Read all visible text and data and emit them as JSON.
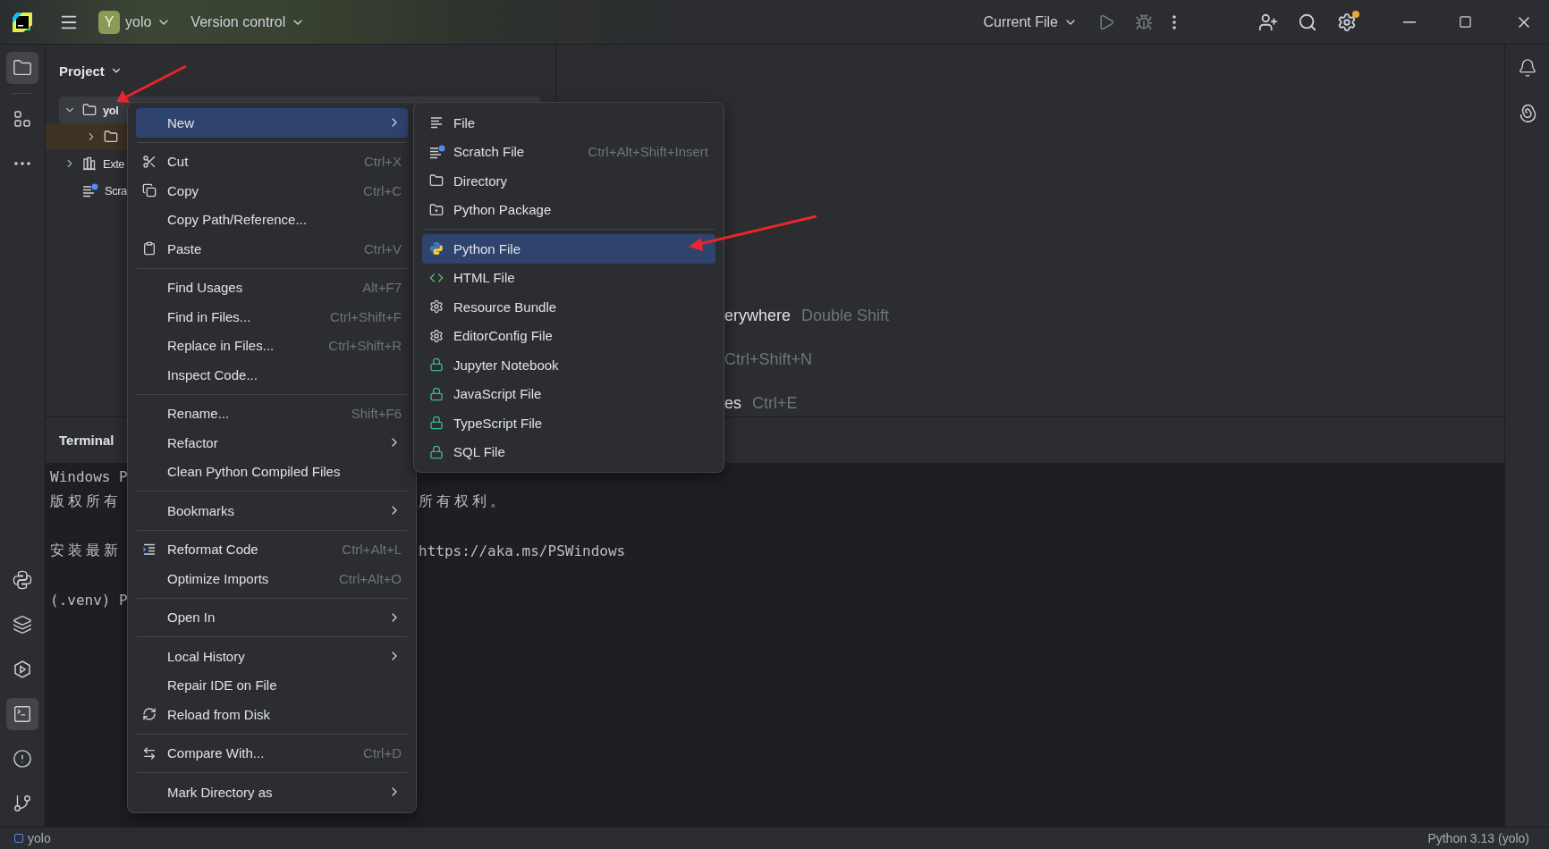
{
  "title_bar": {
    "project_initial": "Y",
    "project": "yolo",
    "vcs": "Version control",
    "run_config": "Current File",
    "run_disabled": true,
    "debug_disabled": true,
    "settings_badge": true
  },
  "tool_strip": {
    "top": [
      {
        "kind": "project",
        "selected": true
      },
      {
        "kind": "structure",
        "selected": false
      },
      {
        "kind": "more",
        "selected": false
      }
    ],
    "bottom": [
      {
        "kind": "python",
        "selected": false
      },
      {
        "kind": "layers",
        "selected": false
      },
      {
        "kind": "run",
        "selected": false
      },
      {
        "kind": "terminal",
        "selected": true
      },
      {
        "kind": "problems",
        "selected": false
      },
      {
        "kind": "git",
        "selected": false
      }
    ]
  },
  "project_panel": {
    "title": "Project",
    "tree": [
      {
        "label": "yol",
        "kind": "folder",
        "expanded": true,
        "selected": true,
        "excluded": false,
        "children": [
          {
            "kind": "folder",
            "expanded": false,
            "selected": false,
            "excluded": true
          }
        ]
      },
      {
        "label": "Exte",
        "kind": "library",
        "expanded": false,
        "selected": false,
        "excluded": false
      },
      {
        "label": "Scra",
        "kind": "scratch",
        "selected": false,
        "excluded": false
      }
    ]
  },
  "editor_hints": [
    {
      "action": "erywhere",
      "shortcut": "Double Shift"
    },
    {
      "shortcut": "Ctrl+Shift+N"
    },
    {
      "action": "es",
      "shortcut": "Ctrl+E"
    }
  ],
  "terminal": {
    "title": "Terminal",
    "lines": [
      {
        "left": "Windows P",
        "gap_before": false
      },
      {
        "left": "版权所有",
        "right": "所有权利。",
        "gap_before": false
      },
      {
        "left": "安装最新",
        "right": "https://aka.ms/PSWindows",
        "gap_before": true
      },
      {
        "left": "(.venv) P",
        "gap_before": true
      }
    ]
  },
  "context_menu": {
    "groups": [
      [
        {
          "label": "New",
          "submenu": true,
          "selected": true
        }
      ],
      [
        {
          "label": "Cut",
          "shortcut": "Ctrl+X",
          "submenu": false,
          "selected": false
        },
        {
          "label": "Copy",
          "shortcut": "Ctrl+C",
          "submenu": false,
          "selected": false
        },
        {
          "label": "Copy Path/Reference...",
          "submenu": false,
          "selected": false
        },
        {
          "label": "Paste",
          "shortcut": "Ctrl+V",
          "submenu": false,
          "selected": false
        }
      ],
      [
        {
          "label": "Find Usages",
          "shortcut": "Alt+F7",
          "submenu": false,
          "selected": false
        },
        {
          "label": "Find in Files...",
          "shortcut": "Ctrl+Shift+F",
          "submenu": false,
          "selected": false
        },
        {
          "label": "Replace in Files...",
          "shortcut": "Ctrl+Shift+R",
          "submenu": false,
          "selected": false
        },
        {
          "label": "Inspect Code...",
          "submenu": false,
          "selected": false
        }
      ],
      [
        {
          "label": "Rename...",
          "shortcut": "Shift+F6",
          "submenu": false,
          "selected": false
        },
        {
          "label": "Refactor",
          "submenu": true,
          "selected": false
        },
        {
          "label": "Clean Python Compiled Files",
          "submenu": false,
          "selected": false
        }
      ],
      [
        {
          "label": "Bookmarks",
          "submenu": true,
          "selected": false
        }
      ],
      [
        {
          "label": "Reformat Code",
          "shortcut": "Ctrl+Alt+L",
          "submenu": false,
          "selected": false
        },
        {
          "label": "Optimize Imports",
          "shortcut": "Ctrl+Alt+O",
          "submenu": false,
          "selected": false
        }
      ],
      [
        {
          "label": "Open In",
          "submenu": true,
          "selected": false
        }
      ],
      [
        {
          "label": "Local History",
          "submenu": true,
          "selected": false
        },
        {
          "label": "Repair IDE on File",
          "submenu": false,
          "selected": false
        },
        {
          "label": "Reload from Disk",
          "submenu": false,
          "selected": false
        }
      ],
      [
        {
          "label": "Compare With...",
          "shortcut": "Ctrl+D",
          "submenu": false,
          "selected": false
        }
      ],
      [
        {
          "label": "Mark Directory as",
          "submenu": true,
          "selected": false
        }
      ]
    ]
  },
  "new_submenu": {
    "groups": [
      [
        {
          "label": "File",
          "selected": false
        },
        {
          "label": "Scratch File",
          "shortcut": "Ctrl+Alt+Shift+Insert",
          "selected": false
        },
        {
          "label": "Directory",
          "selected": false
        },
        {
          "label": "Python Package",
          "selected": false
        }
      ],
      [
        {
          "label": "Python File",
          "selected": true
        },
        {
          "label": "HTML File",
          "selected": false
        },
        {
          "label": "Resource Bundle",
          "selected": false
        },
        {
          "label": "EditorConfig File",
          "selected": false
        },
        {
          "label": "Jupyter Notebook",
          "selected": false
        },
        {
          "label": "JavaScript File",
          "selected": false
        },
        {
          "label": "TypeScript File",
          "selected": false
        },
        {
          "label": "SQL File",
          "selected": false
        }
      ]
    ]
  },
  "status_bar": {
    "project": "yolo",
    "interpreter": "Python 3.13 (yolo)"
  }
}
